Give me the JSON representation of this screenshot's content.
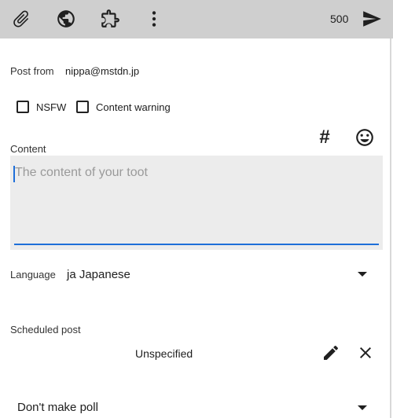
{
  "toolbar": {
    "icons": [
      "attachment-icon",
      "globe-icon",
      "puzzle-icon",
      "more-vert-icon",
      "send-icon"
    ],
    "char_count": "500"
  },
  "post_from": {
    "label": "Post from",
    "account": "nippa@mstdn.jp"
  },
  "options": {
    "nsfw_label": "NSFW",
    "cw_label": "Content warning"
  },
  "content": {
    "label": "Content",
    "hashtag_symbol": "#",
    "placeholder": "The content of your toot",
    "accent": "#1e6fd9"
  },
  "language": {
    "label": "Language",
    "value": "ja Japanese"
  },
  "scheduled": {
    "label": "Scheduled post",
    "value": "Unspecified"
  },
  "poll": {
    "value": "Don't make poll"
  }
}
